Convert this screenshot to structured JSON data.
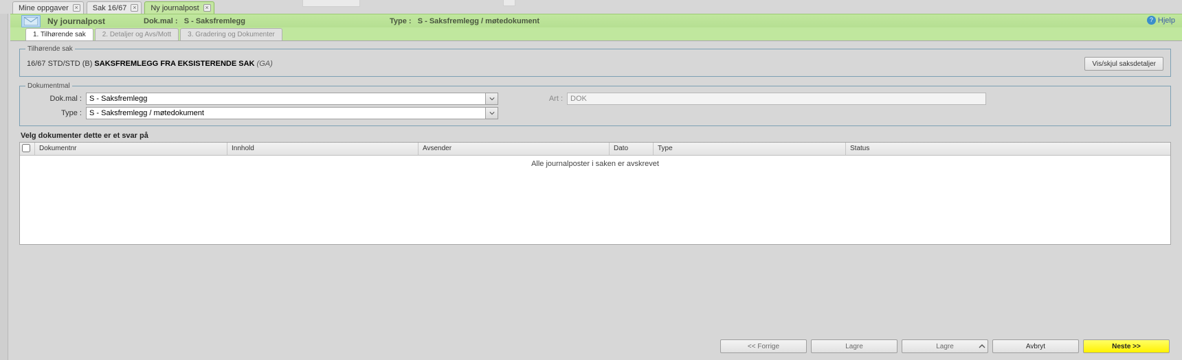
{
  "app_tabs": [
    {
      "label": "Mine oppgaver",
      "active": false
    },
    {
      "label": "Sak 16/67",
      "active": false
    },
    {
      "label": "Ny journalpost",
      "active": true
    }
  ],
  "header": {
    "title": "Ny journalpost",
    "dokmal_label": "Dok.mal :",
    "dokmal_value": "S - Saksfremlegg",
    "type_label": "Type :",
    "type_value": "S - Saksfremlegg / møtedokument",
    "help": "Hjelp"
  },
  "steps": [
    {
      "label": "1. Tilhørende sak",
      "active": true
    },
    {
      "label": "2. Detaljer og Avs/Mott",
      "active": false
    },
    {
      "label": "3. Gradering og Dokumenter",
      "active": false
    }
  ],
  "case": {
    "legend": "Tilhørende sak",
    "prefix": "16/67 STD/STD (B)",
    "title": "SAKSFREMLEGG FRA EKSISTERENDE SAK",
    "suffix": "(GA)",
    "toggle": "Vis/skjul saksdetaljer"
  },
  "dokmal": {
    "legend": "Dokumentmal",
    "dokmal_label": "Dok.mal :",
    "dokmal_value": "S - Saksfremlegg",
    "type_label": "Type :",
    "type_value": "S - Saksfremlegg / møtedokument",
    "art_label": "Art :",
    "art_value": "DOK"
  },
  "reply_section": {
    "title": "Velg dokumenter dette er et svar på",
    "columns": [
      "Dokumentnr",
      "Innhold",
      "Avsender",
      "Dato",
      "Type",
      "Status"
    ],
    "empty": "Alle journalposter i saken er avskrevet"
  },
  "actions": {
    "prev": "<< Forrige",
    "save1": "Lagre",
    "save2": "Lagre",
    "cancel": "Avbryt",
    "next": "Neste >>"
  }
}
